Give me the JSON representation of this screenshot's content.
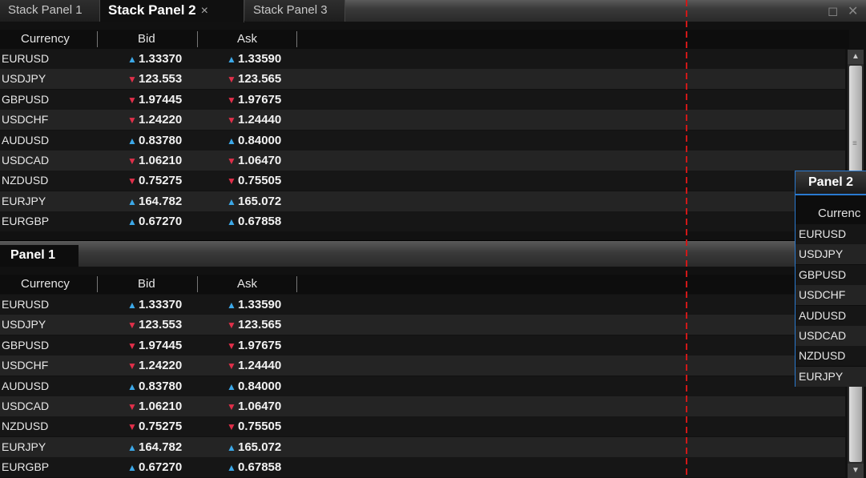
{
  "tabs": [
    {
      "label": "Stack Panel 1",
      "active": false
    },
    {
      "label": "Stack Panel 2",
      "active": true,
      "close": "×"
    },
    {
      "label": "Stack Panel 3",
      "active": false
    }
  ],
  "window_buttons": {
    "restore": "◻",
    "close": "✕"
  },
  "columns": {
    "currency": "Currency",
    "bid": "Bid",
    "ask": "Ask"
  },
  "rates": [
    {
      "currency": "EURUSD",
      "bid": "1.33370",
      "bid_dir": "up",
      "ask": "1.33590",
      "ask_dir": "up"
    },
    {
      "currency": "USDJPY",
      "bid": "123.553",
      "bid_dir": "down",
      "ask": "123.565",
      "ask_dir": "down"
    },
    {
      "currency": "GBPUSD",
      "bid": "1.97445",
      "bid_dir": "down",
      "ask": "1.97675",
      "ask_dir": "down"
    },
    {
      "currency": "USDCHF",
      "bid": "1.24220",
      "bid_dir": "down",
      "ask": "1.24440",
      "ask_dir": "down"
    },
    {
      "currency": "AUDUSD",
      "bid": "0.83780",
      "bid_dir": "up",
      "ask": "0.84000",
      "ask_dir": "up"
    },
    {
      "currency": "USDCAD",
      "bid": "1.06210",
      "bid_dir": "down",
      "ask": "1.06470",
      "ask_dir": "down"
    },
    {
      "currency": "NZDUSD",
      "bid": "0.75275",
      "bid_dir": "down",
      "ask": "0.75505",
      "ask_dir": "down"
    },
    {
      "currency": "EURJPY",
      "bid": "164.782",
      "bid_dir": "up",
      "ask": "165.072",
      "ask_dir": "up"
    },
    {
      "currency": "EURGBP",
      "bid": "0.67270",
      "bid_dir": "up",
      "ask": "0.67858",
      "ask_dir": "up"
    }
  ],
  "panel1": {
    "title": "Panel 1"
  },
  "panel2": {
    "title": "Panel 2",
    "header": "Currenc",
    "currencies": [
      "EURUSD",
      "USDJPY",
      "GBPUSD",
      "USDCHF",
      "AUDUSD",
      "USDCAD",
      "NZDUSD",
      "EURJPY"
    ]
  },
  "arrows": {
    "up": "▲",
    "down": "▼"
  },
  "colors": {
    "up": "#3ca8e8",
    "down": "#e0304a",
    "accent": "#2a7ad0",
    "drop_guide": "#d01818"
  }
}
